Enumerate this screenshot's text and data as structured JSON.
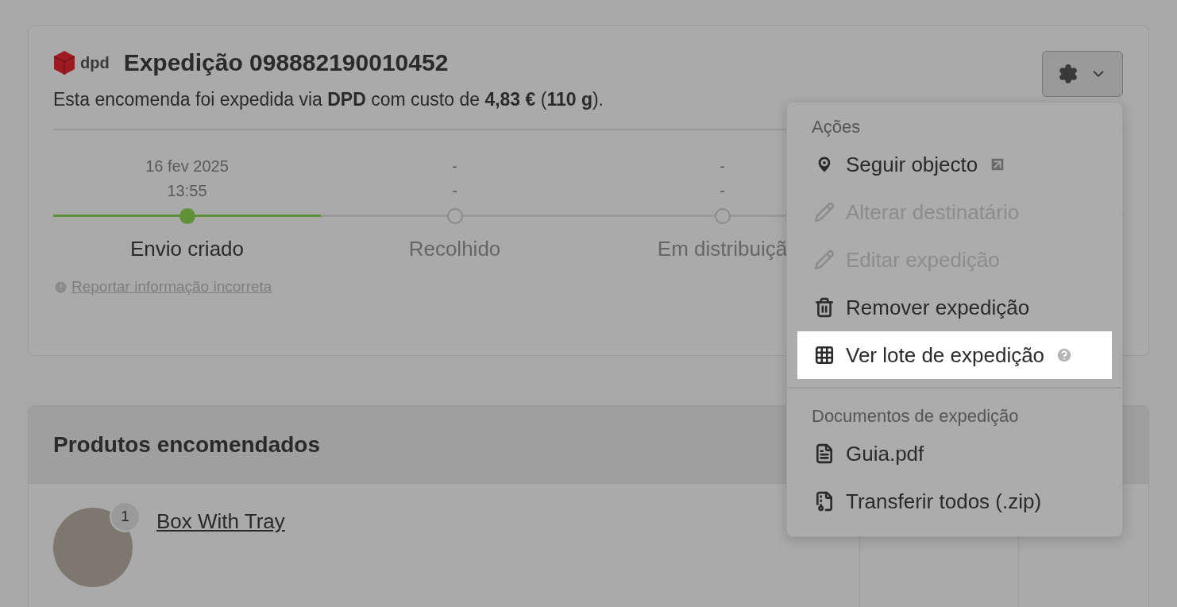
{
  "shipment": {
    "carrier_logo": "dpd",
    "title": "Expedição 098882190010452",
    "summary": "Esta encomenda foi expedida via **DPD** com custo de **4,83 €** (**110 g**).",
    "steps": [
      {
        "date": "16 fev 2025",
        "time": "13:55",
        "label": "Envio criado",
        "done": true
      },
      {
        "date": "-",
        "time": "-",
        "label": "Recolhido",
        "done": false
      },
      {
        "date": "-",
        "time": "-",
        "label": "Em distribuiçã",
        "done": false
      }
    ],
    "report_link": "Reportar informação incorreta"
  },
  "menu": {
    "sections": [
      {
        "title": "Ações",
        "items": [
          {
            "kind": "track",
            "label": "Seguir objecto",
            "disabled": false,
            "selected": false
          },
          {
            "kind": "edit",
            "label": "Alterar destinatário",
            "disabled": true,
            "selected": false
          },
          {
            "kind": "edit",
            "label": "Editar expedição",
            "disabled": true,
            "selected": false
          },
          {
            "kind": "remove",
            "label": "Remover expedição",
            "disabled": false,
            "selected": false
          },
          {
            "kind": "batch",
            "label": "Ver lote de expedição",
            "disabled": false,
            "selected": true
          }
        ]
      },
      {
        "title": "Documentos de expedição",
        "items": [
          {
            "kind": "pdf",
            "label": "Guia.pdf",
            "disabled": false,
            "selected": false
          },
          {
            "kind": "zip",
            "label": "Transferir todos (.zip)",
            "disabled": false,
            "selected": false
          }
        ]
      }
    ]
  },
  "products": {
    "title": "Produtos encomendados",
    "rows": [
      {
        "quantity": "1",
        "name": "Box With Tray"
      }
    ]
  }
}
